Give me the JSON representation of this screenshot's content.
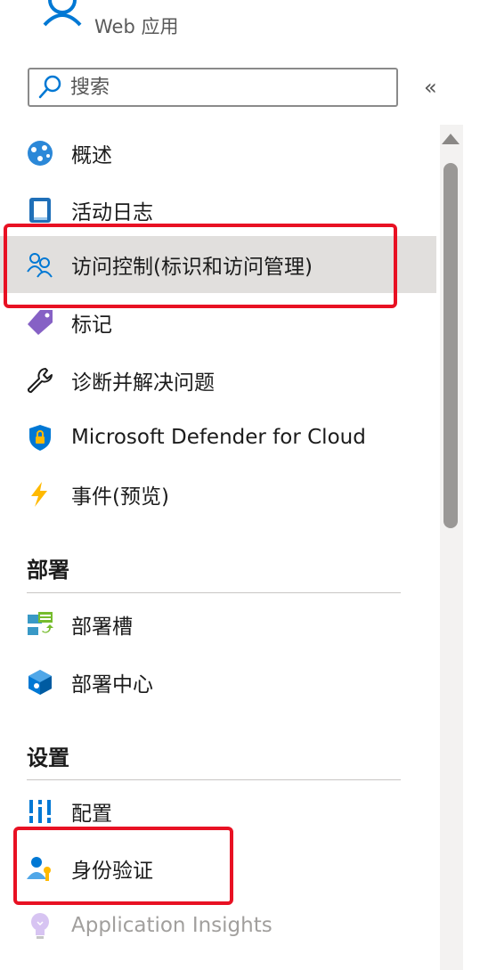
{
  "header": {
    "subtitle": "Web 应用"
  },
  "search": {
    "placeholder": "搜索"
  },
  "collapse": {
    "label": "«"
  },
  "menu": {
    "items": [
      {
        "label": "概述"
      },
      {
        "label": "活动日志"
      },
      {
        "label": "访问控制(标识和访问管理)"
      },
      {
        "label": "标记"
      },
      {
        "label": "诊断并解决问题"
      },
      {
        "label": "Microsoft Defender for Cloud"
      },
      {
        "label": "事件(预览)"
      }
    ]
  },
  "sections": {
    "deployment": {
      "title": "部署",
      "items": [
        {
          "label": "部署槽"
        },
        {
          "label": "部署中心"
        }
      ]
    },
    "settings": {
      "title": "设置",
      "items": [
        {
          "label": "配置"
        },
        {
          "label": "身份验证"
        },
        {
          "label": "Application Insights"
        }
      ]
    }
  },
  "colors": {
    "highlight": "#e81123",
    "selected": "#e1dfdd",
    "accent": "#0078d4"
  }
}
